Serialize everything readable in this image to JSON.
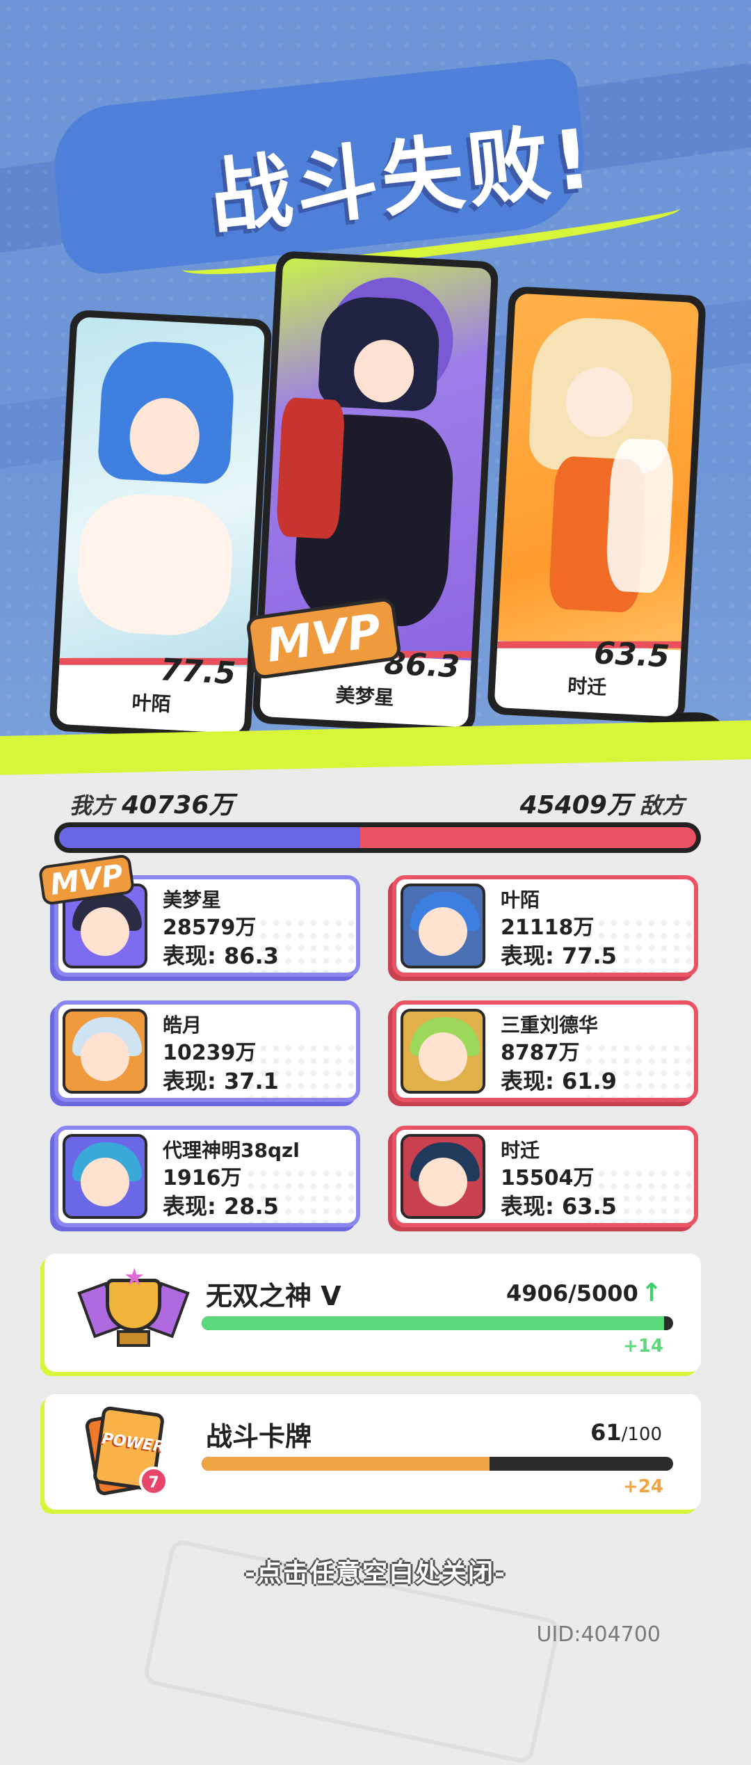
{
  "title": "战斗失败!",
  "heroes": [
    {
      "name": "叶陌",
      "score": "77.5"
    },
    {
      "name": "美梦星",
      "score": "86.3",
      "mvp": "MVP"
    },
    {
      "name": "时迁",
      "score": "63.5"
    }
  ],
  "blob_face": "> <",
  "team_summary": {
    "ours_label": "我方",
    "ours_total": "40736万",
    "enemy_label": "敌方",
    "enemy_total": "45409万",
    "ours_share": 0.473
  },
  "mvp_mini": "MVP",
  "players": {
    "allies": [
      {
        "name": "美梦星",
        "power": "28579万",
        "perf": "表现: 86.3"
      },
      {
        "name": "皓月",
        "power": "10239万",
        "perf": "表现: 37.1"
      },
      {
        "name": "代理神明38qzl",
        "power": "1916万",
        "perf": "表现: 28.5"
      }
    ],
    "enemies": [
      {
        "name": "叶陌",
        "power": "21118万",
        "perf": "表现: 77.5"
      },
      {
        "name": "三重刘德华",
        "power": "8787万",
        "perf": "表现: 61.9"
      },
      {
        "name": "时迁",
        "power": "15504万",
        "perf": "表现: 63.5"
      }
    ]
  },
  "rank": {
    "title": "无双之神 V",
    "value": "4906/5000",
    "progress": 0.9812,
    "delta": "+14",
    "accent": "#5bd97a"
  },
  "battle_card": {
    "title": "战斗卡牌",
    "value_current": "61",
    "value_max": "/100",
    "progress": 0.61,
    "delta": "+24",
    "accent": "#f0a443",
    "card_text": "POWER",
    "badge": "7"
  },
  "close_hint": "-点击任意空白处关闭-",
  "uid": "UID:404700"
}
